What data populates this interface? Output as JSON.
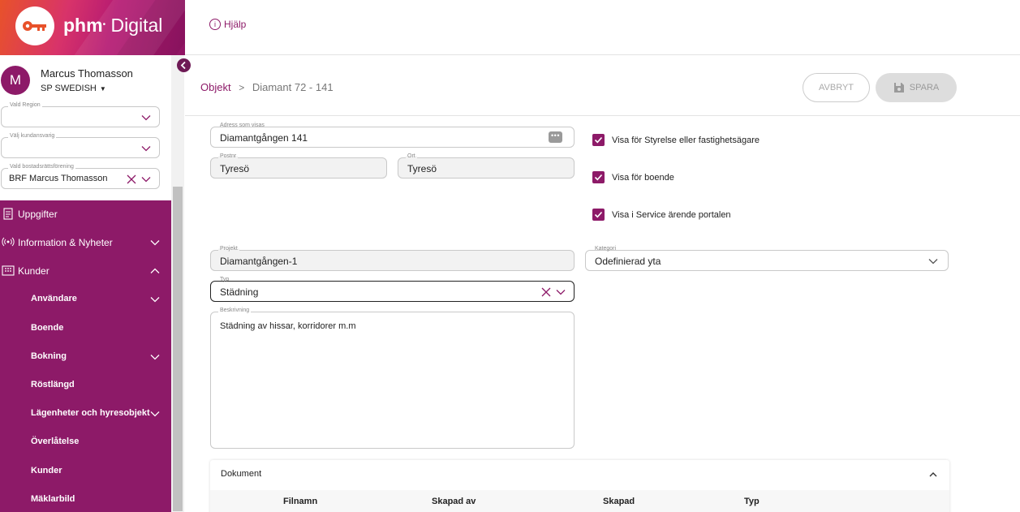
{
  "brand": {
    "name_bold": "phm",
    "name_rest": "Digital",
    "reg": "•"
  },
  "topbar": {
    "help_label": "Hjälp",
    "help_icon": "i"
  },
  "user": {
    "initial": "M",
    "name": "Marcus Thomasson",
    "org": "SP SWEDISH"
  },
  "sidebar_fields": [
    {
      "label": "Vald Region",
      "value": ""
    },
    {
      "label": "Välj kundansvarig",
      "value": ""
    },
    {
      "label": "Vald bostadsrättsförening",
      "value": "BRF Marcus Thomasson"
    }
  ],
  "menu": [
    {
      "label": "Uppgifter",
      "icon": "clipboard-icon",
      "level": "top",
      "chevron": "none"
    },
    {
      "label": "Information & Nyheter",
      "icon": "broadcast-icon",
      "level": "top",
      "chevron": "down"
    },
    {
      "label": "Kunder",
      "icon": "building-icon",
      "level": "top",
      "chevron": "up"
    },
    {
      "label": "Användare",
      "level": "sub",
      "chevron": "down"
    },
    {
      "label": "Boende",
      "level": "sub",
      "chevron": "none"
    },
    {
      "label": "Bokning",
      "level": "sub",
      "chevron": "down"
    },
    {
      "label": "Röstlängd",
      "level": "sub",
      "chevron": "none"
    },
    {
      "label": "Lägenheter och hyresobjekt",
      "level": "sub",
      "chevron": "down"
    },
    {
      "label": "Överlåtelse",
      "level": "sub",
      "chevron": "none"
    },
    {
      "label": "Kunder",
      "level": "sub",
      "chevron": "none"
    },
    {
      "label": "Mäklarbild",
      "level": "sub",
      "chevron": "none"
    }
  ],
  "breadcrumb": {
    "root": "Objekt",
    "separator": ">",
    "current": "Diamant 72 - 141"
  },
  "actions": {
    "cancel": "AVBRYT",
    "save": "SPARA"
  },
  "form": {
    "address": {
      "label": "Adress som visas",
      "value": "Diamantgången 141"
    },
    "postnr": {
      "label": "Postnr",
      "value": "Tyresö"
    },
    "ort": {
      "label": "Ort",
      "value": "Tyresö"
    },
    "projekt": {
      "label": "Projekt",
      "value": "Diamantgången-1"
    },
    "kategori": {
      "label": "Kategori",
      "value": "Odefinierad yta"
    },
    "typ": {
      "label": "Typ",
      "value": "Städning"
    },
    "beskrivning": {
      "label": "Beskrivning",
      "value": "Städning av hissar, korridorer m.m"
    }
  },
  "checkboxes": [
    {
      "label": "Visa för Styrelse eller fastighetsägare",
      "checked": true
    },
    {
      "label": "Visa för boende",
      "checked": true
    },
    {
      "label": "Visa i Service ärende portalen",
      "checked": true
    }
  ],
  "documents": {
    "title": "Dokument",
    "columns": [
      "Filnamn",
      "Skapad av",
      "Skapad",
      "Typ"
    ]
  },
  "colors": {
    "accent": "#8d1a68",
    "brand_gradient_start": "#e8522a",
    "brand_gradient_end": "#8f1463"
  }
}
